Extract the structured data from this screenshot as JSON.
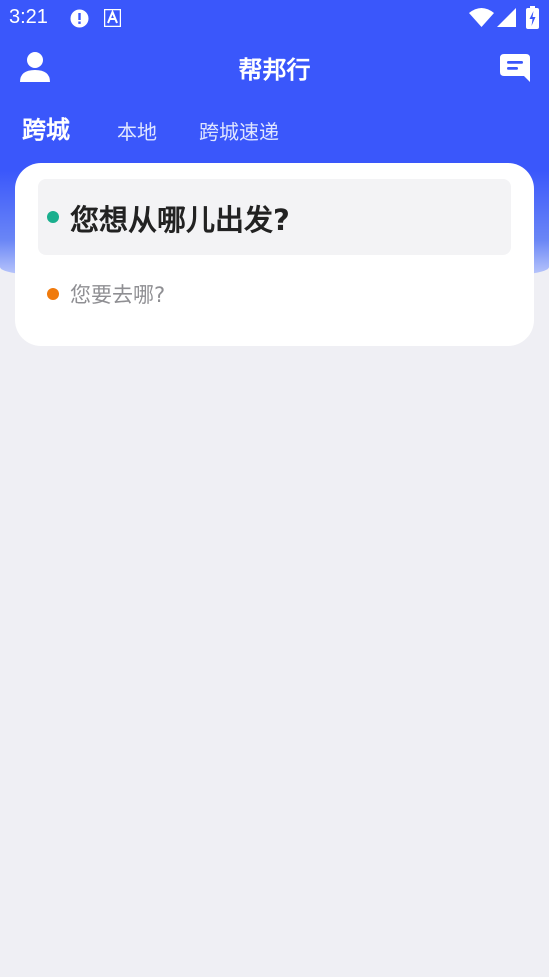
{
  "status_bar": {
    "time": "3:21",
    "icons": [
      "alert-icon",
      "font-icon",
      "wifi-icon",
      "signal-icon",
      "battery-icon"
    ]
  },
  "header": {
    "title": "帮邦行",
    "left_icon": "user-icon",
    "right_icon": "message-icon"
  },
  "tabs": [
    {
      "label": "跨城",
      "active": true
    },
    {
      "label": "本地",
      "active": false
    },
    {
      "label": "跨城速递",
      "active": false
    }
  ],
  "route_card": {
    "from_placeholder": "您想从哪儿出发?",
    "to_placeholder": "您要去哪?",
    "from_dot_color": "#1aaf8e",
    "to_dot_color": "#f07a0c"
  },
  "colors": {
    "primary": "#3a57fb",
    "background": "#efeff4"
  }
}
